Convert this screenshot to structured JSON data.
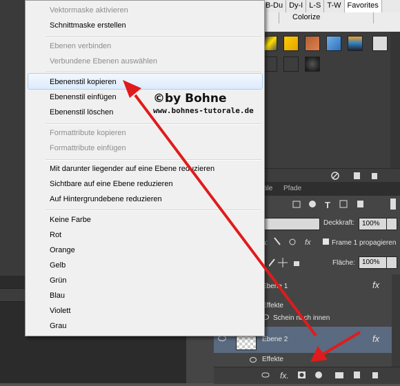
{
  "top_tabs": [
    "B-Du",
    "Dy-I",
    "L-S",
    "T-W",
    "Favorites"
  ],
  "top_tab_partial": "o",
  "colorize_label": "Colorize",
  "row34_text": "s",
  "context_menu": {
    "items": [
      {
        "label": "Vektormaske aktivieren",
        "disabled": true
      },
      {
        "label": "Schnittmaske erstellen",
        "disabled": false
      },
      {
        "label": "Ebenen verbinden",
        "disabled": true
      },
      {
        "label": "Verbundene Ebenen auswählen",
        "disabled": true
      },
      {
        "label": "Ebenenstil kopieren",
        "disabled": false,
        "highlighted": true
      },
      {
        "label": "Ebenenstil einfügen",
        "disabled": false
      },
      {
        "label": "Ebenenstil löschen",
        "disabled": false
      },
      {
        "label": "Formattribute kopieren",
        "disabled": true
      },
      {
        "label": "Formattribute einfügen",
        "disabled": true
      },
      {
        "label": "Mit darunter liegender auf eine Ebene reduzieren",
        "disabled": false
      },
      {
        "label": "Sichtbare auf eine Ebene reduzieren",
        "disabled": false
      },
      {
        "label": "Auf Hintergrundebene reduzieren",
        "disabled": false
      },
      {
        "label": "Keine Farbe",
        "disabled": false
      },
      {
        "label": "Rot",
        "disabled": false
      },
      {
        "label": "Orange",
        "disabled": false
      },
      {
        "label": "Gelb",
        "disabled": false
      },
      {
        "label": "Grün",
        "disabled": false
      },
      {
        "label": "Blau",
        "disabled": false
      },
      {
        "label": "Violett",
        "disabled": false
      },
      {
        "label": "Grau",
        "disabled": false
      }
    ]
  },
  "watermark": {
    "by": "©by Bohne",
    "url": "www.bohnes-tutorale.de"
  },
  "layers_panel": {
    "tabs": [
      "äle",
      "Pfade"
    ],
    "opacity_label": "Deckkraft:",
    "opacity_value": "100%",
    "fill_label": "Fläche:",
    "fill_value": "100%",
    "lock_label": "n:",
    "propagate_label": "Frame 1 propagieren",
    "layers": [
      {
        "name": "Ebene 1",
        "effects_label": "Effekte",
        "effect": "Schein nach innen",
        "fx": "fx"
      },
      {
        "name": "Ebene 2",
        "effects_label": "Effekte",
        "fx": "fx",
        "selected": true
      }
    ]
  },
  "colors": {
    "arrow": "#e01b1b",
    "menu_bg": "#f0f0f0",
    "highlight": "#dcebfc",
    "panel_dark": "#454545"
  },
  "icons": [
    "search-icon",
    "fx-icon",
    "eye-icon",
    "link-icon",
    "mask-icon",
    "folder-icon",
    "new-layer-icon",
    "trash-icon",
    "lock-icon",
    "move-icon",
    "brush-icon",
    "no-icon",
    "type-icon",
    "image-icon"
  ]
}
